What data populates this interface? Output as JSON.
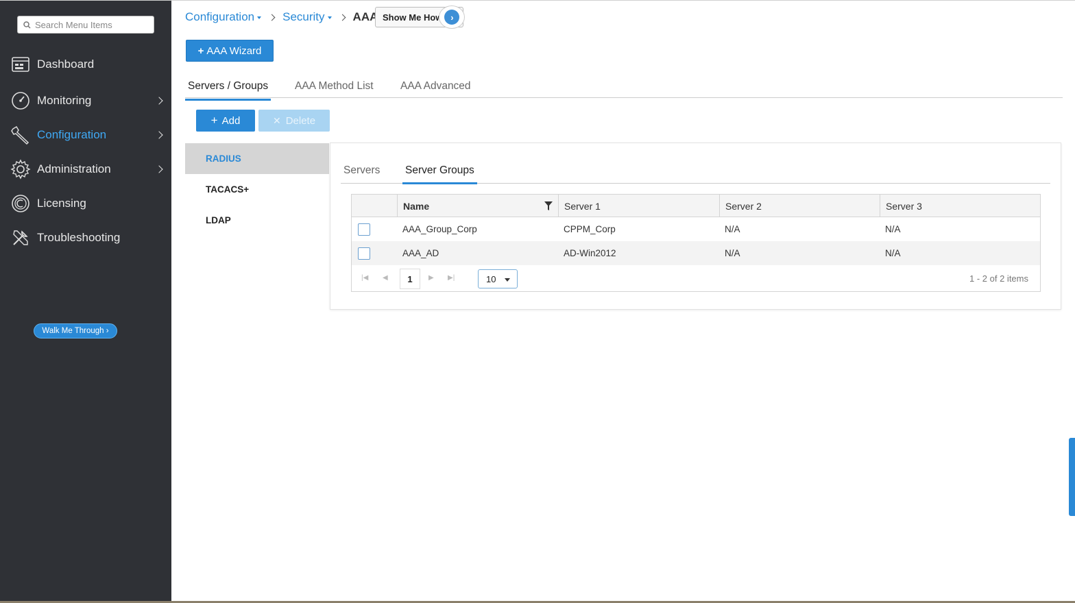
{
  "sidebar": {
    "search_placeholder": "Search Menu Items",
    "items": [
      {
        "label": "Dashboard",
        "icon": "dashboard-icon",
        "has_chevron": false
      },
      {
        "label": "Monitoring",
        "icon": "gauge-icon",
        "has_chevron": true
      },
      {
        "label": "Configuration",
        "icon": "wrench-icon",
        "has_chevron": true,
        "active": true
      },
      {
        "label": "Administration",
        "icon": "gear-icon",
        "has_chevron": true
      },
      {
        "label": "Licensing",
        "icon": "license-icon",
        "has_chevron": false
      },
      {
        "label": "Troubleshooting",
        "icon": "tools-icon",
        "has_chevron": false
      }
    ],
    "walk_me_label": "Walk Me Through ›"
  },
  "breadcrumb": {
    "items": [
      "Configuration",
      "Security"
    ],
    "current": "AAA",
    "show_me_how": "Show Me How"
  },
  "wizard_label": "AAA Wizard",
  "tabs": [
    "Servers / Groups",
    "AAA Method List",
    "AAA Advanced"
  ],
  "toolbar": {
    "add_label": "Add",
    "delete_label": "Delete"
  },
  "protocols": [
    "RADIUS",
    "TACACS+",
    "LDAP"
  ],
  "sub_tabs": [
    "Servers",
    "Server Groups"
  ],
  "table": {
    "columns": [
      "Name",
      "Server 1",
      "Server 2",
      "Server 3"
    ],
    "rows": [
      [
        "AAA_Group_Corp",
        "CPPM_Corp",
        "N/A",
        "N/A"
      ],
      [
        "AAA_AD",
        "AD-Win2012",
        "N/A",
        "N/A"
      ]
    ]
  },
  "pager": {
    "page": "1",
    "page_size": "10",
    "info": "1 - 2 of 2 items"
  },
  "colors": {
    "accent": "#2a89d6",
    "sidebar_bg": "#2f3136",
    "active_nav": "#3fa9f5"
  }
}
